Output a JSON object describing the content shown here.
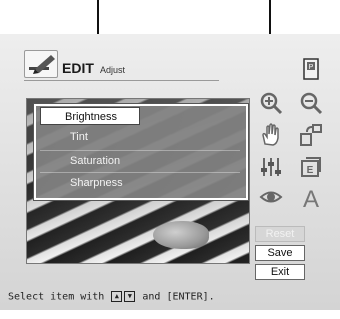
{
  "header": {
    "title": "EDIT",
    "subtitle": "Adjust"
  },
  "menu": {
    "items": [
      {
        "label": "Brightness",
        "selected": true
      },
      {
        "label": "Tint",
        "selected": false
      },
      {
        "label": "Saturation",
        "selected": false
      },
      {
        "label": "Sharpness",
        "selected": false
      }
    ]
  },
  "toolbar": {
    "icons": [
      "print-icon",
      "zoom-in-icon",
      "zoom-out-icon",
      "hand-move-icon",
      "rotate-icon",
      "adjust-sliders-icon",
      "effect-icon",
      "red-eye-icon",
      "text-icon"
    ],
    "text_icon_glyph": "A"
  },
  "buttons": {
    "reset": "Reset",
    "save": "Save",
    "exit": "Exit"
  },
  "status": {
    "prefix": "Select item with",
    "suffix": "and [ENTER]."
  },
  "colors": {
    "panel": "#dedede",
    "menu_bg": "#828282",
    "selected_bg": "#ffffff",
    "disabled_button": "#d6d6d6"
  }
}
